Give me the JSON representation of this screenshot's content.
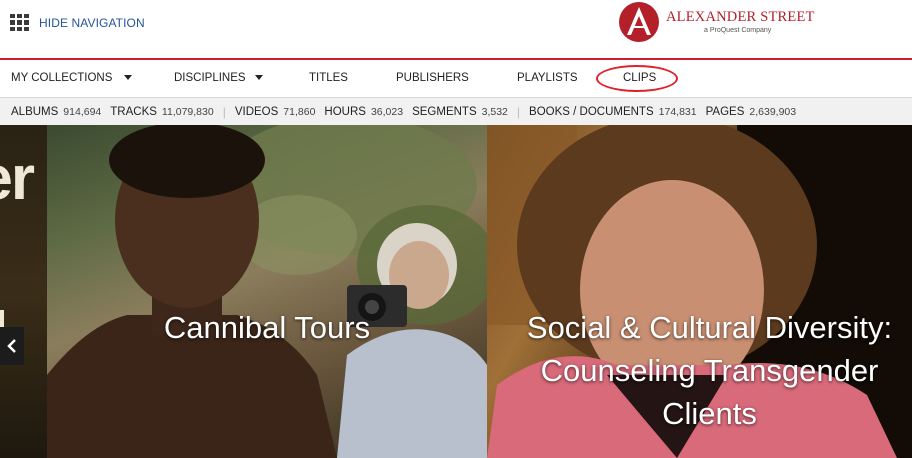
{
  "header": {
    "hide_nav_label": "HIDE NAVIGATION",
    "logo_name": "ALEXANDER STREET",
    "logo_tagline": "a ProQuest Company",
    "brand_color": "#c8202e"
  },
  "nav": {
    "items": [
      {
        "label": "MY COLLECTIONS",
        "dropdown": true
      },
      {
        "label": "DISCIPLINES",
        "dropdown": true
      },
      {
        "label": "TITLES",
        "dropdown": false
      },
      {
        "label": "PUBLISHERS",
        "dropdown": false
      },
      {
        "label": "PLAYLISTS",
        "dropdown": false
      },
      {
        "label": "CLIPS",
        "dropdown": false,
        "highlighted": true
      }
    ],
    "highlight_color": "#e0202a"
  },
  "stats": [
    {
      "label": "ALBUMS",
      "value": "914,694"
    },
    {
      "label": "TRACKS",
      "value": "11,079,830"
    },
    {
      "label": "VIDEOS",
      "value": "71,860"
    },
    {
      "label": "HOURS",
      "value": "36,023"
    },
    {
      "label": "SEGMENTS",
      "value": "3,532"
    },
    {
      "label": "BOOKS / DOCUMENTS",
      "value": "174,831"
    },
    {
      "label": "PAGES",
      "value": "2,639,903"
    }
  ],
  "carousel": {
    "prev_peek_text": "er",
    "slides": [
      {
        "title": "Cannibal Tours"
      },
      {
        "title_lines": [
          "Social & Cultural Diversity:",
          "Counseling Transgender",
          "Clients"
        ]
      }
    ],
    "prev_icon": "chevron-left-icon"
  }
}
